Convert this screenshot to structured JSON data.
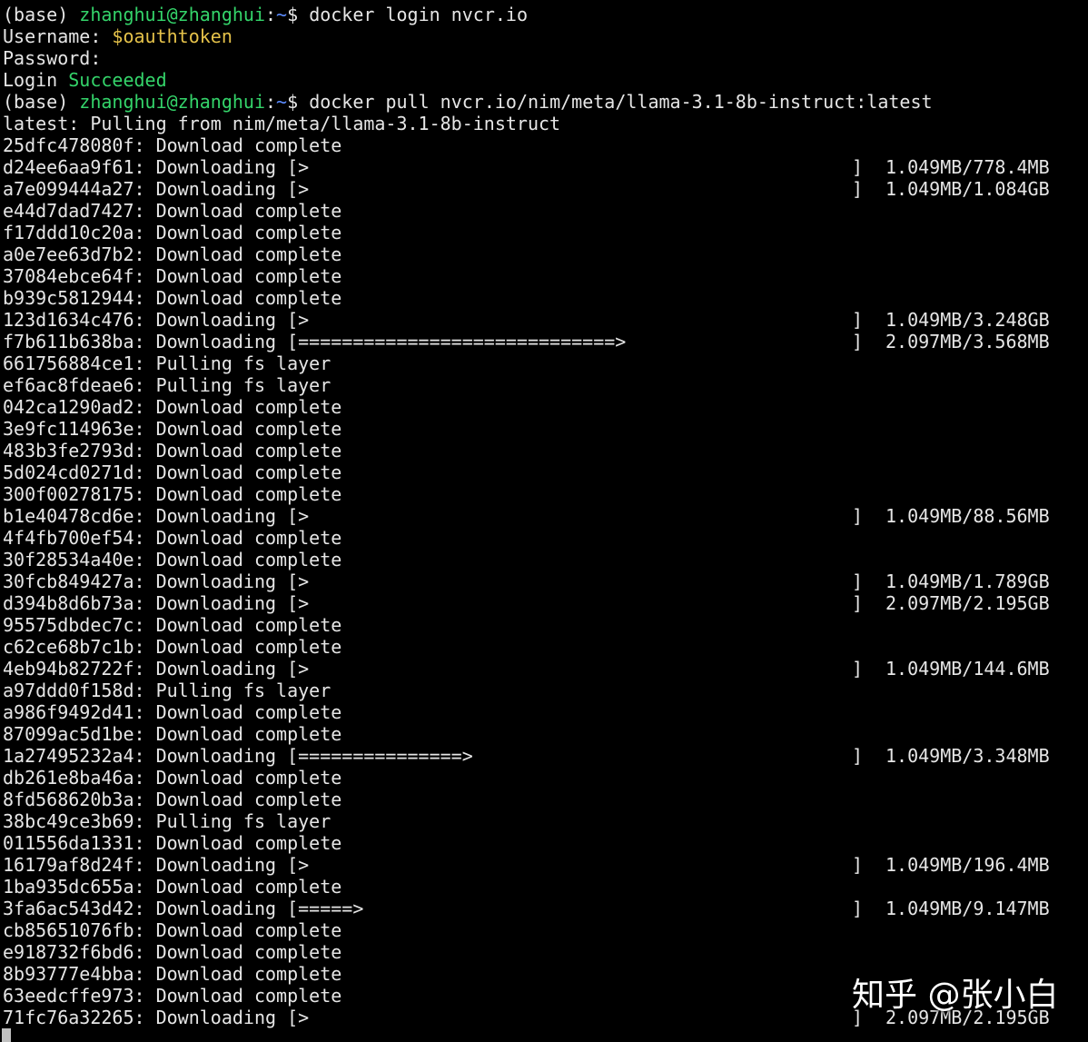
{
  "terminal": {
    "prompt": {
      "env": "(base) ",
      "user_host": "zhanghui@zhanghui",
      "sep": ":",
      "path": "~",
      "dollar": "$ "
    },
    "login": {
      "command": "docker login nvcr.io",
      "username_label": "Username: ",
      "username_value": "$oauthtoken",
      "password_label": "Password:",
      "result_prefix": "Login ",
      "result_status": "Succeeded"
    },
    "pull": {
      "command": "docker pull nvcr.io/nim/meta/llama-3.1-8b-instruct:latest",
      "header": "latest: Pulling from nim/meta/llama-3.1-8b-instruct"
    },
    "layers": [
      {
        "text": "25dfc478080f: Download complete"
      },
      {
        "text": "d24ee6aa9f61: Downloading [>",
        "bracket": "]",
        "size": "1.049MB/778.4MB"
      },
      {
        "text": "a7e099444a27: Downloading [>",
        "bracket": "]",
        "size": "1.049MB/1.084GB"
      },
      {
        "text": "e44d7dad7427: Download complete"
      },
      {
        "text": "f17ddd10c20a: Download complete"
      },
      {
        "text": "a0e7ee63d7b2: Download complete"
      },
      {
        "text": "37084ebce64f: Download complete"
      },
      {
        "text": "b939c5812944: Download complete"
      },
      {
        "text": "123d1634c476: Downloading [>",
        "bracket": "]",
        "size": "1.049MB/3.248GB"
      },
      {
        "text": "f7b611b638ba: Downloading [=============================>",
        "bracket": "]",
        "size": "2.097MB/3.568MB"
      },
      {
        "text": "661756884ce1: Pulling fs layer"
      },
      {
        "text": "ef6ac8fdeae6: Pulling fs layer"
      },
      {
        "text": "042ca1290ad2: Download complete"
      },
      {
        "text": "3e9fc114963e: Download complete"
      },
      {
        "text": "483b3fe2793d: Download complete"
      },
      {
        "text": "5d024cd0271d: Download complete"
      },
      {
        "text": "300f00278175: Download complete"
      },
      {
        "text": "b1e40478cd6e: Downloading [>",
        "bracket": "]",
        "size": "1.049MB/88.56MB"
      },
      {
        "text": "4f4fb700ef54: Download complete"
      },
      {
        "text": "30f28534a40e: Download complete"
      },
      {
        "text": "30fcb849427a: Downloading [>",
        "bracket": "]",
        "size": "1.049MB/1.789GB"
      },
      {
        "text": "d394b8d6b73a: Downloading [>",
        "bracket": "]",
        "size": "2.097MB/2.195GB"
      },
      {
        "text": "95575dbdec7c: Download complete"
      },
      {
        "text": "c62ce68b7c1b: Download complete"
      },
      {
        "text": "4eb94b82722f: Downloading [>",
        "bracket": "]",
        "size": "1.049MB/144.6MB"
      },
      {
        "text": "a97ddd0f158d: Pulling fs layer"
      },
      {
        "text": "a986f9492d41: Download complete"
      },
      {
        "text": "87099ac5d1be: Download complete"
      },
      {
        "text": "1a27495232a4: Downloading [===============>",
        "bracket": "]",
        "size": "1.049MB/3.348MB"
      },
      {
        "text": "db261e8ba46a: Download complete"
      },
      {
        "text": "8fd568620b3a: Download complete"
      },
      {
        "text": "38bc49ce3b69: Pulling fs layer"
      },
      {
        "text": "011556da1331: Download complete"
      },
      {
        "text": "16179af8d24f: Downloading [>",
        "bracket": "]",
        "size": "1.049MB/196.4MB"
      },
      {
        "text": "1ba935dc655a: Download complete"
      },
      {
        "text": "3fa6ac543d42: Downloading [=====>",
        "bracket": "]",
        "size": "1.049MB/9.147MB"
      },
      {
        "text": "cb85651076fb: Download complete"
      },
      {
        "text": "e918732f6bd6: Download complete"
      },
      {
        "text": "8b93777e4bba: Download complete"
      },
      {
        "text": "63eedcffe973: Download complete"
      },
      {
        "text": "71fc76a32265: Downloading [>",
        "bracket": "]",
        "size": "2.097MB/2.195GB"
      }
    ]
  },
  "watermark": {
    "text": "知乎 @张小白"
  },
  "colors": {
    "background": "#000000",
    "foreground": "#e6e6e6",
    "prompt_user": "#34d46a",
    "prompt_path": "#5c8cff",
    "status_success": "#34d46a",
    "token": "#e5c24a"
  }
}
